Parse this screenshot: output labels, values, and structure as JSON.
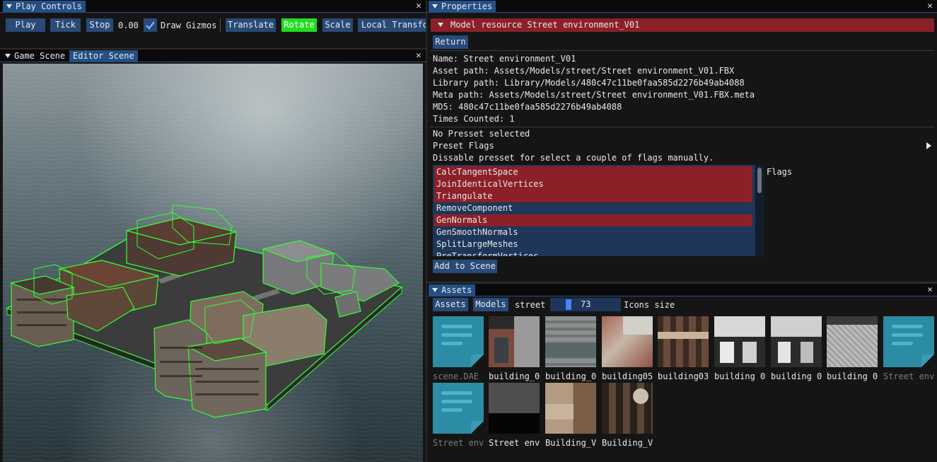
{
  "play_controls": {
    "title": "Play Controls",
    "play": "Play",
    "tick": "Tick",
    "stop": "Stop",
    "time": "0.00",
    "draw_gizmos": "Draw Gizmos",
    "draw_gizmos_checked": true,
    "translate": "Translate",
    "rotate": "Rotate",
    "scale": "Scale",
    "local_transform": "Local Transfo"
  },
  "scene": {
    "tabs": [
      "Game Scene",
      "Editor Scene"
    ],
    "active_tab": "Editor Scene"
  },
  "properties": {
    "title": "Properties",
    "header": "Model resource Street environment_V01",
    "return": "Return",
    "info": [
      "Name: Street environment_V01",
      "Asset path: Assets/Models/street/Street environment_V01.FBX",
      "Library path: Library/Models/480c47c11be0faa585d2276b49ab4088",
      "Meta path: Assets/Models/street/Street environment_V01.FBX.meta",
      "MD5: 480c47c11be0faa585d2276b49ab4088",
      "Times Counted: 1"
    ],
    "no_preset": "No Presset selected",
    "preset_flags": "Preset Flags",
    "dissable": "Dissable presset for select a couple of flags manually.",
    "flags_label": "Flags",
    "flags": [
      {
        "name": "CalcTangentSpace",
        "selected": true
      },
      {
        "name": "JoinIdenticalVertices",
        "selected": true
      },
      {
        "name": "Triangulate",
        "selected": true
      },
      {
        "name": "RemoveComponent",
        "selected": false
      },
      {
        "name": "GenNormals",
        "selected": true
      },
      {
        "name": "GenSmoothNormals",
        "selected": false
      },
      {
        "name": "SplitLargeMeshes",
        "selected": false
      },
      {
        "name": "PreTransformVertices",
        "selected": false
      }
    ],
    "add_to_scene": "Add to Scene"
  },
  "assets": {
    "title": "Assets",
    "crumbs": [
      "Assets",
      "Models",
      "street"
    ],
    "icon_size": "73",
    "icons_size_label": "Icons size",
    "items": [
      {
        "label": "scene.DAE",
        "kind": "document",
        "dim": true
      },
      {
        "label": "building_0",
        "kind": "texture",
        "dim": false
      },
      {
        "label": "building_0",
        "kind": "texture",
        "dim": false
      },
      {
        "label": "building05",
        "kind": "texture",
        "dim": false
      },
      {
        "label": "building03",
        "kind": "texture",
        "dim": false
      },
      {
        "label": "building 0",
        "kind": "texture",
        "dim": false
      },
      {
        "label": "building 0",
        "kind": "texture",
        "dim": false
      },
      {
        "label": "building 0",
        "kind": "texture",
        "dim": false
      },
      {
        "label": "Street env",
        "kind": "document",
        "dim": true
      },
      {
        "label": "Street env",
        "kind": "document",
        "dim": true
      },
      {
        "label": "Street env",
        "kind": "texture",
        "dim": false
      },
      {
        "label": "Building_V",
        "kind": "texture",
        "dim": false
      },
      {
        "label": "Building_V",
        "kind": "texture",
        "dim": false
      }
    ]
  },
  "colors": {
    "accent_blue": "#294a78",
    "active_green": "#22dd22",
    "selected_red": "#8b2028",
    "gizmo_green": "#33ff33"
  }
}
